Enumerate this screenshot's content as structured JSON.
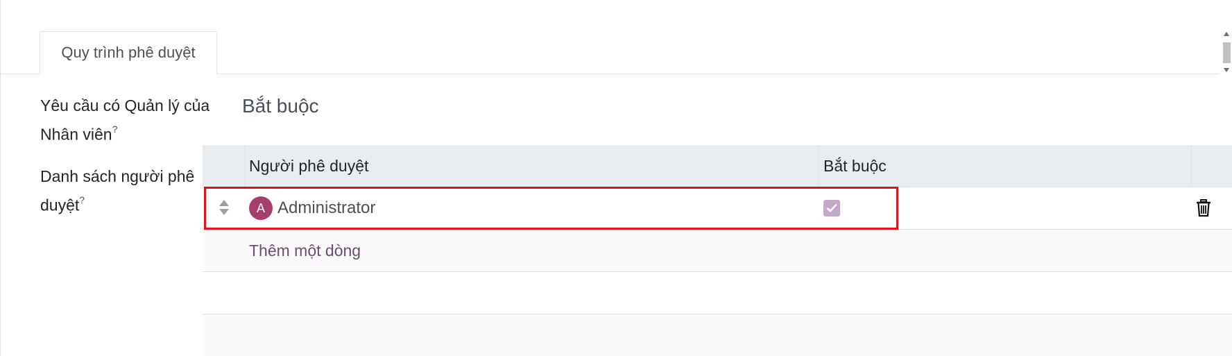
{
  "tabs": [
    {
      "label": "Quy trình phê duyệt"
    }
  ],
  "fields": {
    "manager_required": {
      "label": "Yêu cầu có Quản lý của Nhân viên",
      "help": "?",
      "value": "Bắt buộc"
    },
    "approver_list": {
      "label": "Danh sách người phê duyệt",
      "help": "?"
    }
  },
  "table": {
    "columns": [
      "Người phê duyệt",
      "Bắt buộc"
    ],
    "rows": [
      {
        "avatar_letter": "A",
        "approver": "Administrator",
        "required": true
      }
    ],
    "add_line_label": "Thêm một dòng"
  },
  "colors": {
    "avatar": "#a63e6e",
    "checkbox": "#c3a9c8",
    "link": "#6c4a74",
    "highlight": "#e0121c"
  },
  "icons": [
    "drag-handle-icon",
    "check-icon",
    "trash-icon"
  ]
}
